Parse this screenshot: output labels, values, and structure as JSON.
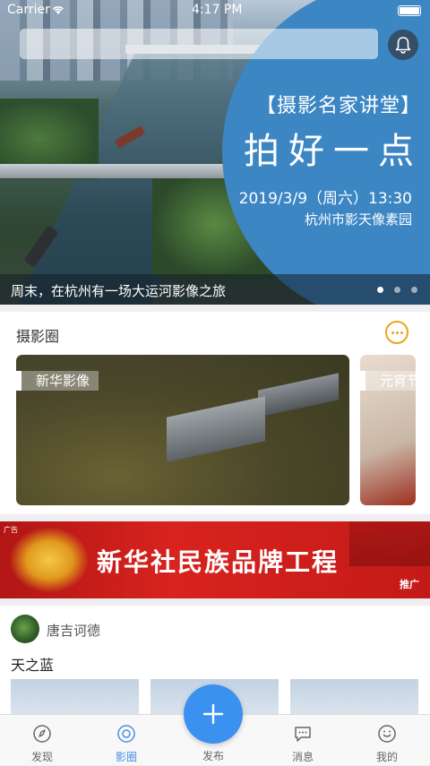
{
  "status_bar": {
    "carrier": "Carrier",
    "time": "4:17 PM"
  },
  "search": {
    "placeholder": ""
  },
  "banner": {
    "promo_title": "【摄影名家讲堂】",
    "promo_main": "拍好一点",
    "promo_date": "2019/3/9（周六）13:30",
    "promo_venue": "杭州市影天像素园",
    "caption": "周末，在杭州有一场大运河影像之旅",
    "slide_count": 3,
    "active_slide": 1
  },
  "circle_section": {
    "title": "摄影圈",
    "cards": [
      {
        "label": "新华影像"
      },
      {
        "label": "元宵节"
      }
    ]
  },
  "ad": {
    "tag": "广告",
    "title": "新华社民族品牌工程",
    "promo_label": "推广"
  },
  "post": {
    "author": "唐吉诃德",
    "title": "天之蓝"
  },
  "tab_bar": {
    "tabs": [
      {
        "label": "发现",
        "icon": "discover-icon"
      },
      {
        "label": "影圈",
        "icon": "circle-icon"
      },
      {
        "label": "发布",
        "icon": "plus-icon"
      },
      {
        "label": "消息",
        "icon": "message-icon"
      },
      {
        "label": "我的",
        "icon": "profile-icon"
      }
    ],
    "active_tab": "影圈"
  },
  "colors": {
    "accent": "#3b91f0",
    "promo_circle": "#3c86c4",
    "more_button": "#f0a21a",
    "ad_red": "#d8231e"
  }
}
